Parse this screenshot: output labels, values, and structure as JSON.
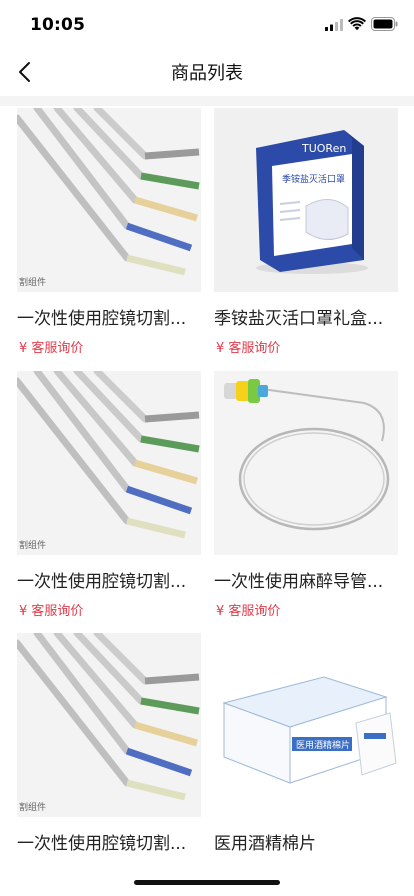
{
  "status_bar": {
    "time": "10:05"
  },
  "header": {
    "title": "商品列表"
  },
  "products": [
    {
      "name": "一次性使用腔镜切割...",
      "price": "¥ 客服询价",
      "sticker": "割组件",
      "image": "stapler-image"
    },
    {
      "name": "季铵盐灭活口罩礼盒...",
      "price": "¥ 客服询价",
      "image": "mask-box-image",
      "box_brand": "TUORen",
      "box_title": "季铵盐灭活口罩"
    },
    {
      "name": "一次性使用腔镜切割...",
      "price": "¥ 客服询价",
      "sticker": "割组件",
      "image": "stapler-image"
    },
    {
      "name": "一次性使用麻醉导管...",
      "price": "¥ 客服询价",
      "image": "catheter-image"
    },
    {
      "name": "一次性使用腔镜切割...",
      "price": "",
      "sticker": "割组件",
      "image": "stapler-image"
    },
    {
      "name": "医用酒精棉片",
      "price": "",
      "image": "alcohol-pad-box-image",
      "box_title": "医用酒精棉片"
    }
  ],
  "colors": {
    "price": "#e23a4a",
    "accent_blue": "#2c4aa8"
  }
}
